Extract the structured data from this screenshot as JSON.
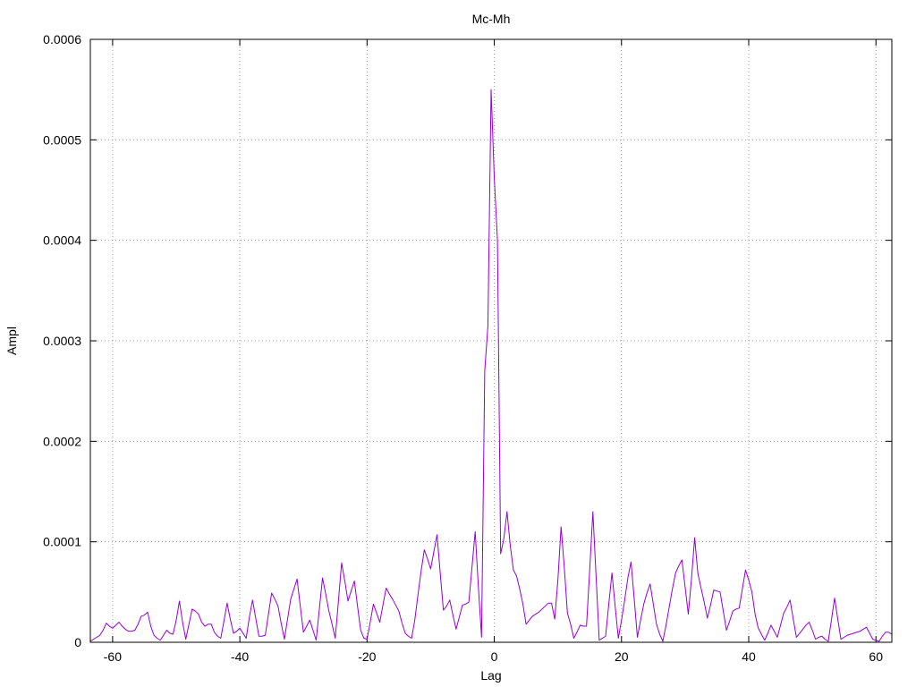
{
  "chart_data": {
    "type": "line",
    "title": "Mc-Mh",
    "xlabel": "Lag",
    "ylabel": "Ampl",
    "xlim": [
      -63.5,
      62.5
    ],
    "ylim": [
      0,
      0.0006
    ],
    "xticks": [
      -60,
      -40,
      -20,
      0,
      20,
      40,
      60
    ],
    "yticks": [
      0,
      0.0001,
      0.0002,
      0.0003,
      0.0004,
      0.0005,
      0.0006
    ],
    "grid": true,
    "line_color": "#9400d3",
    "series": [
      {
        "x": [
          -63.5,
          -63,
          -62.5,
          -62,
          -61.5,
          -61,
          -60.5,
          -60,
          -59.5,
          -59,
          -58.5,
          -58,
          -57.5,
          -57,
          -56.5,
          -56,
          -55.5,
          -55,
          -54.5,
          -54,
          -53.5,
          -53,
          -52.5,
          -52,
          -51.5,
          -51,
          -50.5,
          -50,
          -49.5,
          -49,
          -48.5,
          -48,
          -47.5,
          -47,
          -46.5,
          -46,
          -45.5,
          -45,
          -44.5,
          -44,
          -43.5,
          -43,
          -42.5,
          -42,
          -41.5,
          -41,
          -40.5,
          -40,
          -39.5,
          -39,
          -38.5,
          -38,
          -37.5,
          -37,
          -36.5,
          -36,
          -35.5,
          -35,
          -34.5,
          -34,
          -33.5,
          -33,
          -32.5,
          -32,
          -31.5,
          -31,
          -30.5,
          -30,
          -29.5,
          -29,
          -28.5,
          -28,
          -27.5,
          -27,
          -26.5,
          -26,
          -25.5,
          -25,
          -24.5,
          -24,
          -23.5,
          -23,
          -22.5,
          -22,
          -21.5,
          -21,
          -20.5,
          -20,
          -19.5,
          -19,
          -18.5,
          -18,
          -17.5,
          -17,
          -16.5,
          -16,
          -15.5,
          -15,
          -14.5,
          -14,
          -13.5,
          -13,
          -12.5,
          -12,
          -11.5,
          -11,
          -10.5,
          -10,
          -9.5,
          -9,
          -8.5,
          -8,
          -7.5,
          -7,
          -6.5,
          -6,
          -5.5,
          -5,
          -4.5,
          -4,
          -3.5,
          -3,
          -2.5,
          -2,
          -1.5,
          -1,
          -0.5,
          0,
          0.5,
          1,
          1.5,
          2,
          2.5,
          3,
          3.5,
          4,
          4.5,
          5,
          5.5,
          6,
          6.5,
          7,
          7.5,
          8,
          8.5,
          9,
          9.5,
          10,
          10.5,
          11,
          11.5,
          12,
          12.5,
          13,
          13.5,
          14,
          14.5,
          15,
          15.5,
          16,
          16.5,
          17,
          17.5,
          18,
          18.5,
          19,
          19.5,
          20,
          20.5,
          21,
          21.5,
          22,
          22.5,
          23,
          23.5,
          24,
          24.5,
          25,
          25.5,
          26,
          26.5,
          27,
          27.5,
          28,
          28.5,
          29,
          29.5,
          30,
          30.5,
          31,
          31.5,
          32,
          32.5,
          33,
          33.5,
          34,
          34.5,
          35,
          35.5,
          36,
          36.5,
          37,
          37.5,
          38,
          38.5,
          39,
          39.5,
          40,
          40.5,
          41,
          41.5,
          42,
          42.5,
          43,
          43.5,
          44,
          44.5,
          45,
          45.5,
          46,
          46.5,
          47,
          47.5,
          48,
          48.5,
          49,
          49.5,
          50,
          50.5,
          51,
          51.5,
          52,
          52.5,
          53,
          53.5,
          54,
          54.5,
          55,
          55.5,
          56,
          56.5,
          57,
          57.5,
          58,
          58.5,
          59,
          59.5,
          60,
          60.5,
          61,
          61.5,
          62,
          62.5
        ],
        "y": [
          1e-06,
          3e-06,
          5e-06,
          7e-06,
          1.2e-05,
          1.9e-05,
          1.6e-05,
          1.4e-05,
          1.7e-05,
          2e-05,
          1.6e-05,
          1.3e-05,
          1.1e-05,
          1.1e-05,
          1.2e-05,
          1.8e-05,
          2.6e-05,
          2.7e-05,
          3e-05,
          1.6e-05,
          7e-06,
          4e-06,
          2e-06,
          7e-06,
          1.2e-05,
          9e-06,
          8e-06,
          2.2e-05,
          4.1e-05,
          2e-05,
          3e-06,
          1.8e-05,
          3.3e-05,
          3.1e-05,
          2.8e-05,
          2e-05,
          1.6e-05,
          1.8e-05,
          1.8e-05,
          1e-05,
          6e-06,
          4e-06,
          2.1e-05,
          3.9e-05,
          2.3e-05,
          9e-06,
          1.1e-05,
          1.4e-05,
          9e-06,
          4e-06,
          2.5e-05,
          4.2e-05,
          2.4e-05,
          6e-06,
          6e-06,
          7e-06,
          2.8e-05,
          4.9e-05,
          4.3e-05,
          3.6e-05,
          1.9e-05,
          3e-06,
          2.3e-05,
          4.3e-05,
          5.3e-05,
          6.3e-05,
          3.6e-05,
          1e-05,
          1.6e-05,
          2.2e-05,
          1.2e-05,
          2e-06,
          3.3e-05,
          6.4e-05,
          4.8e-05,
          3.1e-05,
          1.8e-05,
          4e-06,
          4.1e-05,
          7.9e-05,
          6.1e-05,
          4.1e-05,
          5.1e-05,
          6.1e-05,
          3.6e-05,
          1.2e-05,
          4e-06,
          3e-06,
          2e-05,
          3.8e-05,
          2.9e-05,
          2e-05,
          3.7e-05,
          5.4e-05,
          4.8e-05,
          4.3e-05,
          3.7e-05,
          3.1e-05,
          1.9e-05,
          9e-06,
          6e-06,
          4e-06,
          2.2e-05,
          4.7e-05,
          7.1e-05,
          9.2e-05,
          8.3e-05,
          7.3e-05,
          9e-05,
          0.000107,
          6.9e-05,
          3.2e-05,
          3.6e-05,
          4.2e-05,
          2.7e-05,
          1.3e-05,
          2.5e-05,
          3.7e-05,
          3.8e-05,
          4e-05,
          7.5e-05,
          0.00011,
          5.5e-05,
          5e-06,
          0.00027,
          0.000315,
          0.00055,
          0.000462,
          0.0004,
          8.8e-05,
          0.000103,
          0.00013,
          9.7e-05,
          7.2e-05,
          6.6e-05,
          5.3e-05,
          3.8e-05,
          1.8e-05,
          2.2e-05,
          2.6e-05,
          2.8e-05,
          3e-05,
          3.3e-05,
          3.6e-05,
          3.9e-05,
          3.9e-05,
          2.3e-05,
          6.2e-05,
          0.000115,
          7.5e-05,
          2.9e-05,
          1.8e-05,
          4e-06,
          1e-05,
          1.7e-05,
          1.6e-05,
          1.6e-05,
          7.2e-05,
          0.00013,
          6.6e-05,
          2e-06,
          4e-06,
          6e-06,
          3.8e-05,
          6.9e-05,
          3.6e-05,
          4e-06,
          2.2e-05,
          4.2e-05,
          6.4e-05,
          8e-05,
          4.3e-05,
          5e-06,
          2.2e-05,
          3.8e-05,
          4.9e-05,
          5.8e-05,
          3.8e-05,
          1.8e-05,
          8e-06,
          1e-06,
          1.7e-05,
          3.5e-05,
          5.3e-05,
          6.9e-05,
          7.6e-05,
          8.2e-05,
          5.5e-05,
          2.8e-05,
          6.3e-05,
          0.000104,
          6.9e-05,
          5.4e-05,
          4e-05,
          2.4e-05,
          3.7e-05,
          5.2e-05,
          5.1e-05,
          5e-05,
          3.1e-05,
          1.2e-05,
          2.1e-05,
          3.1e-05,
          3.3e-05,
          3.4e-05,
          5.3e-05,
          7.2e-05,
          6.2e-05,
          5e-05,
          2.8e-05,
          1.4e-05,
          8e-06,
          2e-06,
          9e-06,
          1.7e-05,
          1.1e-05,
          5e-06,
          1.7e-05,
          2.9e-05,
          3.5e-05,
          4.2e-05,
          2.3e-05,
          5e-06,
          9e-06,
          1.3e-05,
          1.7e-05,
          2e-05,
          1.2e-05,
          3e-06,
          5e-06,
          6e-06,
          3e-06,
          1e-06,
          2.2e-05,
          4.4e-05,
          2.3e-05,
          3e-06,
          5e-06,
          7e-06,
          8e-06,
          9e-06,
          1e-05,
          1.1e-05,
          1.3e-05,
          1.5e-05,
          9e-06,
          3e-06,
          2e-06,
          1e-06,
          6e-06,
          1e-05,
          1e-05,
          8e-06
        ]
      }
    ]
  }
}
